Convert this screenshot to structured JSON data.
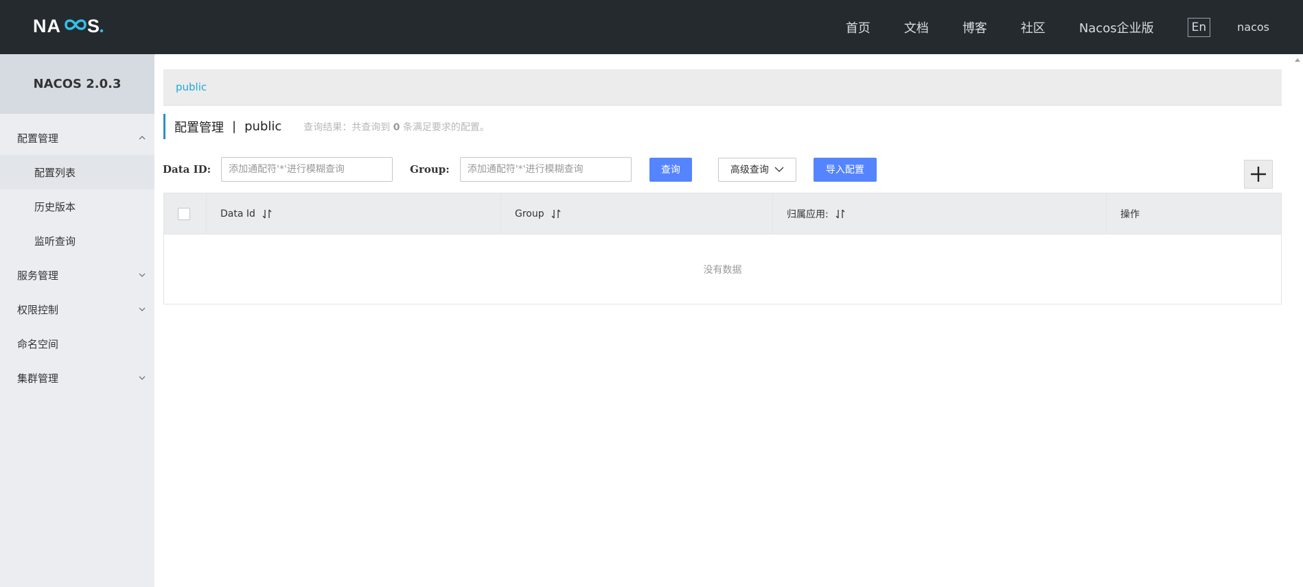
{
  "header": {
    "logo": "NACOS.",
    "nav": [
      "首页",
      "文档",
      "博客",
      "社区",
      "Nacos企业版"
    ],
    "lang_button": "En",
    "user": "nacos"
  },
  "sidebar": {
    "version": "NACOS 2.0.3",
    "items": [
      {
        "label": "配置管理",
        "expanded": true,
        "icon": "chevron-up-icon"
      },
      {
        "label": "配置列表",
        "sub": true,
        "active": true
      },
      {
        "label": "历史版本",
        "sub": true
      },
      {
        "label": "监听查询",
        "sub": true
      },
      {
        "label": "服务管理",
        "icon": "chevron-down-icon"
      },
      {
        "label": "权限控制",
        "icon": "chevron-down-icon"
      },
      {
        "label": "命名空间"
      },
      {
        "label": "集群管理",
        "icon": "chevron-down-icon"
      }
    ]
  },
  "main": {
    "namespace": "public",
    "title": "配置管理",
    "separator": "|",
    "title_ns": "public",
    "result_prefix": "查询结果：共查询到",
    "result_count": "0",
    "result_suffix": "条满足要求的配置。",
    "filter": {
      "data_id_label": "Data ID:",
      "data_id_placeholder": "添加通配符'*'进行模糊查询",
      "group_label": "Group:",
      "group_placeholder": "添加通配符'*'进行模糊查询",
      "query_button": "查询",
      "advanced_button": "高级查询",
      "import_button": "导入配置"
    },
    "table": {
      "columns": [
        "Data Id",
        "Group",
        "归属应用:",
        "操作"
      ],
      "empty_text": "没有数据"
    }
  },
  "colors": {
    "header_bg": "#252a2f",
    "primary": "#5584ff",
    "link": "#21a8d8"
  }
}
